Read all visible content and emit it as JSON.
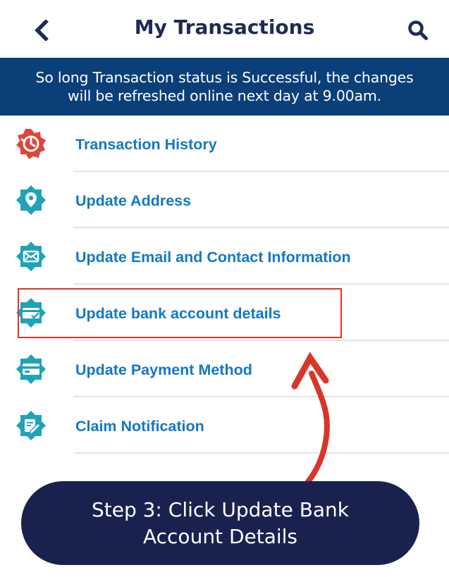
{
  "header": {
    "title": "My Transactions",
    "back_icon": "chevron-left-icon",
    "search_icon": "search-icon"
  },
  "notice": {
    "line1": "So long Transaction status is Successful, the changes",
    "line2": "will be refreshed online next day at 9.00am."
  },
  "menu": {
    "items": [
      {
        "label": "Transaction History",
        "icon": "clock-badge-icon",
        "icon_color": "#e0453a"
      },
      {
        "label": "Update Address",
        "icon": "location-pin-icon",
        "icon_color": "#1fa3b8"
      },
      {
        "label": "Update Email and Contact Information",
        "icon": "envelope-icon",
        "icon_color": "#1fa3b8"
      },
      {
        "label": "Update bank account details",
        "icon": "bank-card-check-icon",
        "icon_color": "#1fa3b8"
      },
      {
        "label": "Update Payment Method",
        "icon": "credit-card-icon",
        "icon_color": "#1fa3b8"
      },
      {
        "label": "Claim Notification",
        "icon": "edit-document-icon",
        "icon_color": "#1fa3b8"
      }
    ]
  },
  "callout": {
    "line1": "Step 3: Click Update Bank",
    "line2": "Account Details"
  },
  "colors": {
    "header_title": "#1f2b55",
    "notice_bg": "#0b3f78",
    "link": "#1378c4",
    "highlight": "#d9352a",
    "callout_bg": "#19224f"
  }
}
